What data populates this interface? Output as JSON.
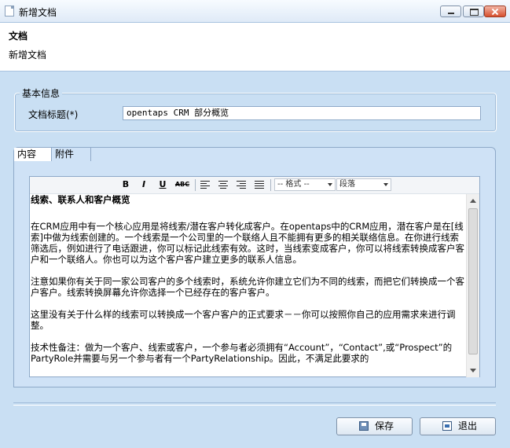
{
  "window": {
    "title": "新增文档",
    "icon": "document-icon"
  },
  "header": {
    "title": "文档",
    "subtitle": "新增文档"
  },
  "basic": {
    "legend": "基本信息",
    "doc_title_label": "文档标题(*)",
    "doc_title_value": "opentaps CRM 部分概览"
  },
  "tabs": {
    "content": "内容",
    "attachments": "附件"
  },
  "toolbar": {
    "bold": "B",
    "italic": "I",
    "underline": "U",
    "strike": "ABC",
    "format_select": "-- 格式 --",
    "paragraph_select": "段落"
  },
  "content": {
    "heading": "线索、联系人和客户概览",
    "p1": "在CRM应用中有一个核心应用是将线索/潜在客户转化成客户。在opentaps中的CRM应用，潜在客户是在[线索]中做为线索创建的。一个线索是一个公司里的一个联络人且不能拥有更多的相关联络信息。在你进行线索筛选后，例如进行了电话跟进，你可以标记此线索有效。这时，当线索变成客户，你可以将线索转换成客户客户和一个联络人。你也可以为这个客户客户建立更多的联系人信息。",
    "p2": "注意如果你有关于同一家公司客户的多个线索时，系统允许你建立它们为不同的线索，而把它们转换成一个客户客户。线索转换屏幕允许你选择一个已经存在的客户客户。",
    "p3": "这里没有关于什么样的线索可以转换成一个客户客户的正式要求－－你可以按照你自己的应用需求来进行调整。",
    "p4": "技术性备注：做为一个客户、线索或客户，一个参与者必须拥有“Account”，“Contact”,或“Prospect”的PartyRole并需要与另一个参与者有一个PartyRelationship。因此，不满足此要求的"
  },
  "buttons": {
    "save": "保存",
    "exit": "退出"
  }
}
